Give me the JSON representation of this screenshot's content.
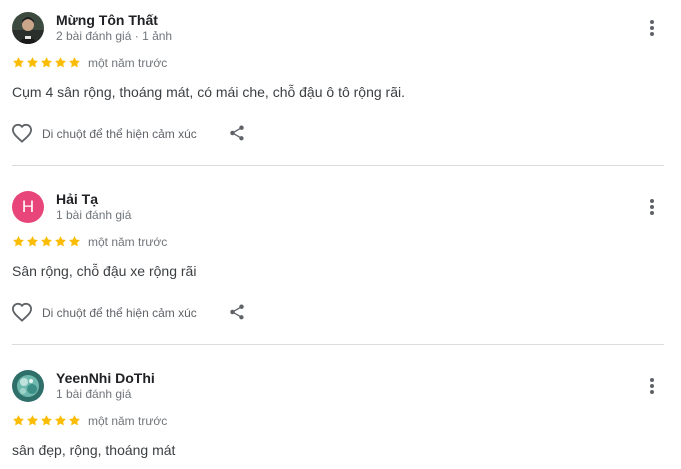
{
  "reviews": [
    {
      "name": "Mừng Tôn Thất",
      "meta": "2 bài đánh giá · 1 ảnh",
      "rating": 5,
      "time": "một năm trước",
      "text": "Cụm 4 sân rộng, thoáng mát, có mái che, chỗ đậu ô tô rộng rãi.",
      "avatar_icon": "photo-avatar",
      "like_label": "Di chuột để thể hiện cảm xúc"
    },
    {
      "name": "Hải Tạ",
      "meta": "1 bài đánh giá",
      "rating": 5,
      "time": "một năm trước",
      "text": "Sân rộng, chỗ đậu xe rộng rãi",
      "avatar_letter": "H",
      "avatar_color": "#e8457a",
      "like_label": "Di chuột để thể hiện cảm xúc"
    },
    {
      "name": "YeenNhi DoThi",
      "meta": "1 bài đánh giá",
      "rating": 5,
      "time": "một năm trước",
      "text": "sân đẹp, rộng, thoáng mát",
      "avatar_icon": "photo-avatar"
    }
  ],
  "colors": {
    "star": "#fbbc04",
    "text_secondary": "#70757a",
    "divider": "#dadce0"
  }
}
